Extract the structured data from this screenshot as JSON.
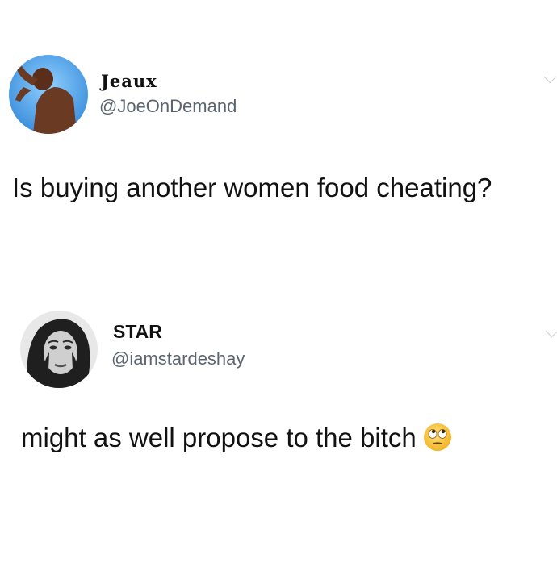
{
  "tweets": [
    {
      "display_name": "Jeaux",
      "handle": "@JoeOnDemand",
      "text": "Is buying another women food cheating?",
      "avatar_icon": "man-avatar-icon",
      "menu_icon": "chevron-down-icon"
    },
    {
      "display_name": "STAR",
      "handle": "@iamstardeshay",
      "text": "might as well propose to the bitch",
      "emoji_icon": "face-with-rolling-eyes-icon",
      "avatar_icon": "woman-avatar-icon",
      "menu_icon": "chevron-down-icon"
    }
  ],
  "colors": {
    "background": "#ffffff",
    "text": "#111111",
    "handle": "#5b6570",
    "avatar_sky": "#57a8e8",
    "emoji_face": "#f7c23c"
  }
}
